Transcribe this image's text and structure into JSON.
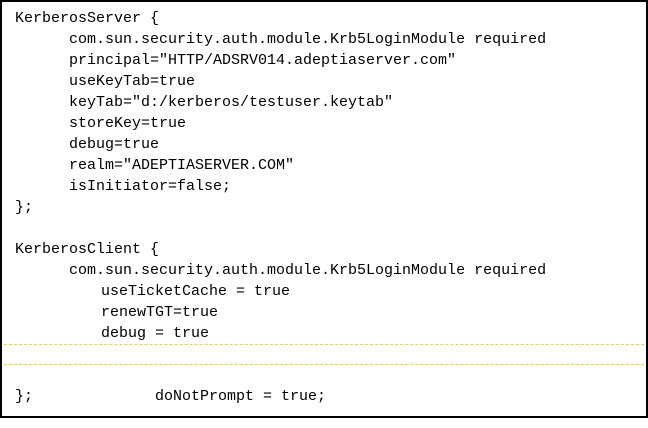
{
  "code": {
    "server": {
      "open": "KerberosServer {",
      "module": "com.sun.security.auth.module.Krb5LoginModule required",
      "principal": "principal=\"HTTP/ADSRV014.adeptiaserver.com\"",
      "use_keytab": "useKeyTab=true",
      "keytab": "keyTab=\"d:/kerberos/testuser.keytab\"",
      "store_key": "storeKey=true",
      "debug": "debug=true",
      "realm": "realm=\"ADEPTIASERVER.COM\"",
      "is_initiator": "isInitiator=false;",
      "close": "};"
    },
    "client": {
      "open": "KerberosClient {",
      "module": "com.sun.security.auth.module.Krb5LoginModule required",
      "use_ticket_cache": "useTicketCache = true",
      "renew_tgt": "renewTGT=true",
      "debug": "debug = true",
      "do_not_prompt": "doNotPrompt = true;",
      "close": "};"
    }
  },
  "colors": {
    "border": "#000000",
    "highlight": "#f2cf3c",
    "text": "#000000"
  }
}
